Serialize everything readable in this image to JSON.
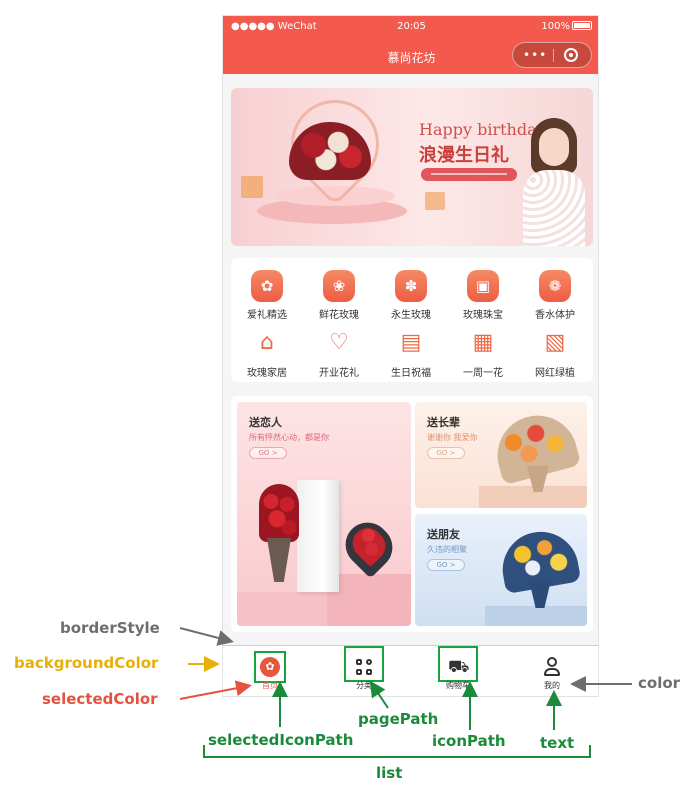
{
  "status_bar": {
    "signal": "●●●●● WeChat",
    "time": "20:05",
    "battery": "100%"
  },
  "nav": {
    "title": "慕尚花坊"
  },
  "banner": {
    "title": "Happy birthday",
    "subtitle": "浪漫生日礼"
  },
  "categories": [
    {
      "label": "爱礼精选",
      "icon": "gift-hand-icon",
      "glyph": "✿"
    },
    {
      "label": "鲜花玫瑰",
      "icon": "rose-icon",
      "glyph": "❀"
    },
    {
      "label": "永生玫瑰",
      "icon": "preserved-rose-icon",
      "glyph": "✽"
    },
    {
      "label": "玫瑰珠宝",
      "icon": "jewelry-icon",
      "glyph": "▣"
    },
    {
      "label": "香水体护",
      "icon": "perfume-icon",
      "glyph": "❁"
    },
    {
      "label": "玫瑰家居",
      "icon": "home-decor-icon",
      "glyph": "⌂"
    },
    {
      "label": "开业花礼",
      "icon": "opening-gift-icon",
      "glyph": "♡"
    },
    {
      "label": "生日祝福",
      "icon": "birthday-icon",
      "glyph": "▤"
    },
    {
      "label": "一周一花",
      "icon": "calendar-icon",
      "glyph": "▦"
    },
    {
      "label": "网红绿植",
      "icon": "plant-icon",
      "glyph": "▧"
    }
  ],
  "promo": {
    "left": {
      "title": "送恋人",
      "subtitle": "所有怦然心动，都是你",
      "go": "GO >"
    },
    "right_top": {
      "title": "送长辈",
      "subtitle": "谢谢你 我爱你",
      "go": "GO >"
    },
    "right_bottom": {
      "title": "送朋友",
      "subtitle": "久违的相聚",
      "go": "GO >"
    }
  },
  "tabbar": {
    "items": [
      {
        "label": "首页",
        "icon": "home-icon",
        "selected": true
      },
      {
        "label": "分类",
        "icon": "category-grid-icon",
        "selected": false
      },
      {
        "label": "购物车",
        "icon": "cart-icon",
        "selected": false
      },
      {
        "label": "我的",
        "icon": "user-icon",
        "selected": false
      }
    ],
    "selected_color": "#f3594c",
    "color": "#333333",
    "background_color": "#ffffff"
  },
  "annotations": {
    "border_style": "borderStyle",
    "background_color": "backgroundColor",
    "selected_color": "selectedColor",
    "page_path": "pagePath",
    "selected_icon_path": "selectedIconPath",
    "icon_path": "iconPath",
    "text": "text",
    "color": "color",
    "list": "list"
  },
  "colors": {
    "nav": "#f3594c",
    "annotation_green": "#1b8a3a",
    "annotation_yellow": "#e8b007",
    "annotation_red": "#e5533f"
  }
}
